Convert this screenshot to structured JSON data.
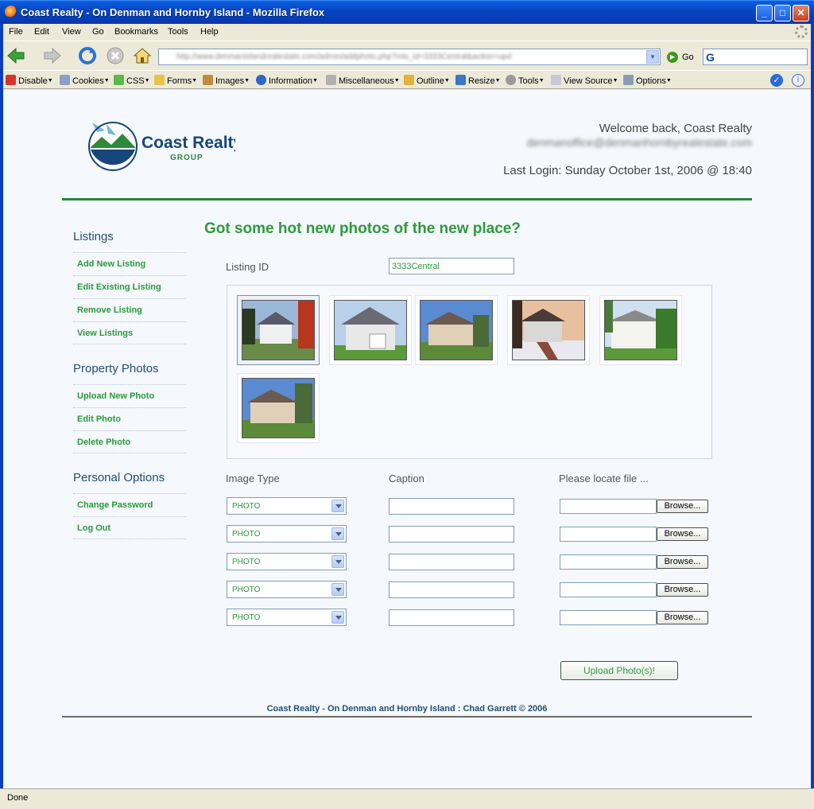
{
  "window": {
    "title": "Coast Realty - On Denman and Hornby Island - Mozilla Firefox"
  },
  "menu": [
    "File",
    "Edit",
    "View",
    "Go",
    "Bookmarks",
    "Tools",
    "Help"
  ],
  "nav": {
    "url": "http://www.denmanislandrealestate.com/admin/addphoto.php?mls_id=3333Central&action=upd",
    "go_label": "Go"
  },
  "devbar": [
    "Disable",
    "Cookies",
    "CSS",
    "Forms",
    "Images",
    "Information",
    "Miscellaneous",
    "Outline",
    "Resize",
    "Tools",
    "View Source",
    "Options"
  ],
  "header": {
    "welcome": "Welcome back, Coast Realty",
    "email": "denmanoffice@denmanhornbyrealestate.com",
    "last_login": "Last Login: Sunday October 1st, 2006 @ 18:40",
    "logo_name": "Coast Realty",
    "logo_sub": "GROUP"
  },
  "sidebar": {
    "sections": [
      {
        "title": "Listings",
        "items": [
          "Add New Listing",
          "Edit Existing Listing",
          "Remove Listing",
          "View Listings"
        ]
      },
      {
        "title": "Property Photos",
        "items": [
          "Upload New Photo",
          "Edit Photo",
          "Delete Photo"
        ]
      },
      {
        "title": "Personal Options",
        "items": [
          "Change Password",
          "Log Out"
        ]
      }
    ]
  },
  "main": {
    "heading": "Got some hot new photos of the new place?",
    "listing_label": "Listing ID",
    "listing_value": "3333Central",
    "columns": {
      "type": "Image Type",
      "caption": "Caption",
      "file": "Please locate file ..."
    },
    "rows": [
      {
        "type": "PHOTO",
        "caption": "",
        "file": "",
        "browse": "Browse..."
      },
      {
        "type": "PHOTO",
        "caption": "",
        "file": "",
        "browse": "Browse..."
      },
      {
        "type": "PHOTO",
        "caption": "",
        "file": "",
        "browse": "Browse..."
      },
      {
        "type": "PHOTO",
        "caption": "",
        "file": "",
        "browse": "Browse..."
      },
      {
        "type": "PHOTO",
        "caption": "",
        "file": "",
        "browse": "Browse..."
      }
    ],
    "upload_label": "Upload Photo(s)!"
  },
  "footer": "Coast Realty - On Denman and Hornby Island : Chad Garrett © 2006",
  "status": "Done",
  "colors": {
    "accent_green": "#2f9a3c",
    "nav_blue": "#1f4e79",
    "titlebar": "#0846c4"
  }
}
